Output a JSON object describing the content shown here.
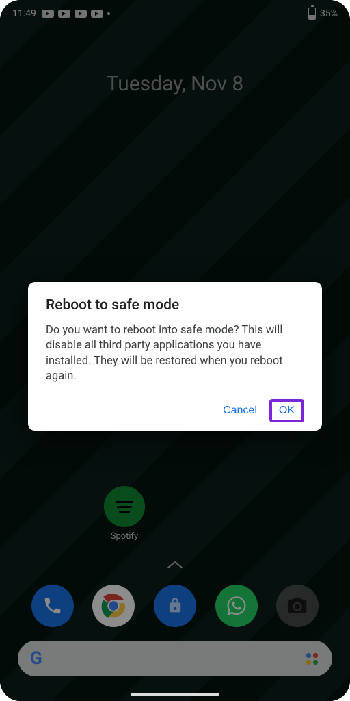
{
  "statusbar": {
    "time": "11:49",
    "battery_pct": "35%"
  },
  "homescreen": {
    "date": "Tuesday, Nov 8",
    "apps": {
      "spotify_label": "Spotify"
    }
  },
  "dialog": {
    "title": "Reboot to safe mode",
    "body": "Do you want to reboot into safe mode? This will disable all third party applications you have installed. They will be restored when you reboot again.",
    "cancel": "Cancel",
    "ok": "OK"
  },
  "colors": {
    "accent": "#1a73e8",
    "highlight_border": "#7b26d8"
  }
}
